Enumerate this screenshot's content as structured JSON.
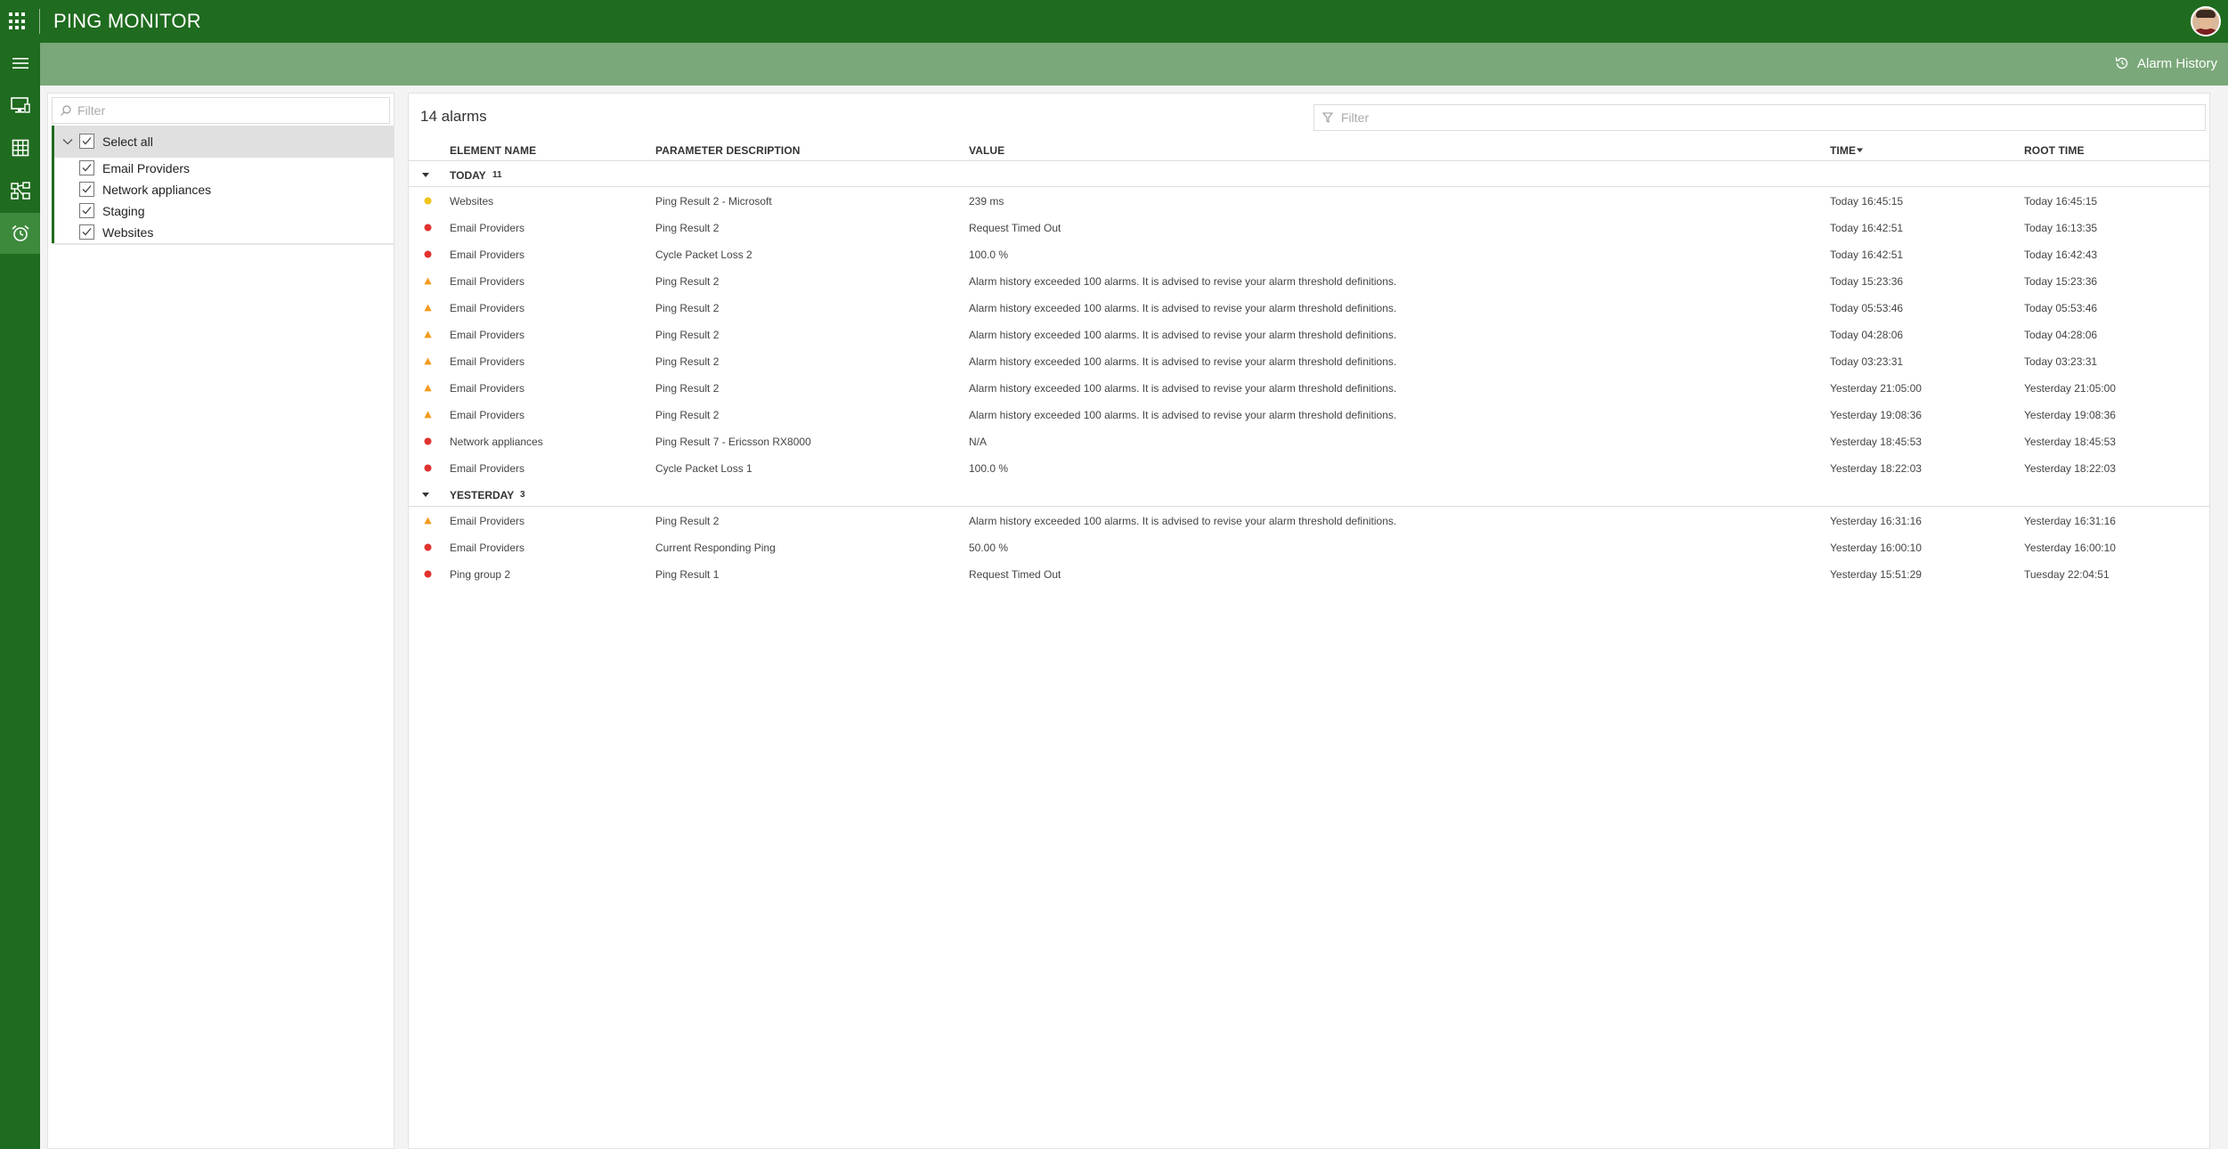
{
  "header": {
    "app_title": "PING MONITOR",
    "alarm_history_label": "Alarm History"
  },
  "rail": {
    "items": [
      {
        "name": "hamburger-menu-icon"
      },
      {
        "name": "monitor-icon"
      },
      {
        "name": "grid-icon"
      },
      {
        "name": "topology-icon"
      },
      {
        "name": "alarm-clock-icon",
        "active": true
      }
    ]
  },
  "left_panel": {
    "filter_placeholder": "Filter",
    "select_all_label": "Select all",
    "items": [
      {
        "label": "Email Providers",
        "checked": true
      },
      {
        "label": "Network appliances",
        "checked": true
      },
      {
        "label": "Staging",
        "checked": true
      },
      {
        "label": "Websites",
        "checked": true
      }
    ]
  },
  "main": {
    "alarm_count": "14 alarms",
    "filter_placeholder": "Filter",
    "columns": {
      "element": "ELEMENT NAME",
      "parameter": "PARAMETER DESCRIPTION",
      "value": "VALUE",
      "time": "TIME",
      "root_time": "ROOT TIME"
    },
    "groups": [
      {
        "name": "TODAY",
        "count": "11",
        "rows": [
          {
            "severity": "minor",
            "element": "Websites",
            "parameter": "Ping Result 2 - Microsoft",
            "value": "239 ms",
            "time": "Today 16:45:15",
            "root_time": "Today 16:45:15"
          },
          {
            "severity": "critical",
            "element": "Email Providers",
            "parameter": "Ping Result 2",
            "value": "Request Timed Out",
            "time": "Today 16:42:51",
            "root_time": "Today 16:13:35"
          },
          {
            "severity": "critical",
            "element": "Email Providers",
            "parameter": "Cycle Packet Loss 2",
            "value": "100.0 %",
            "time": "Today 16:42:51",
            "root_time": "Today 16:42:43"
          },
          {
            "severity": "warning",
            "element": "Email Providers",
            "parameter": "Ping Result 2",
            "value": "Alarm history exceeded 100 alarms. It is advised to revise your alarm threshold definitions.",
            "time": "Today 15:23:36",
            "root_time": "Today 15:23:36"
          },
          {
            "severity": "warning",
            "element": "Email Providers",
            "parameter": "Ping Result 2",
            "value": "Alarm history exceeded 100 alarms. It is advised to revise your alarm threshold definitions.",
            "time": "Today 05:53:46",
            "root_time": "Today 05:53:46"
          },
          {
            "severity": "warning",
            "element": "Email Providers",
            "parameter": "Ping Result 2",
            "value": "Alarm history exceeded 100 alarms. It is advised to revise your alarm threshold definitions.",
            "time": "Today 04:28:06",
            "root_time": "Today 04:28:06"
          },
          {
            "severity": "warning",
            "element": "Email Providers",
            "parameter": "Ping Result 2",
            "value": "Alarm history exceeded 100 alarms. It is advised to revise your alarm threshold definitions.",
            "time": "Today 03:23:31",
            "root_time": "Today 03:23:31"
          },
          {
            "severity": "warning",
            "element": "Email Providers",
            "parameter": "Ping Result 2",
            "value": "Alarm history exceeded 100 alarms. It is advised to revise your alarm threshold definitions.",
            "time": "Yesterday 21:05:00",
            "root_time": "Yesterday 21:05:00"
          },
          {
            "severity": "warning",
            "element": "Email Providers",
            "parameter": "Ping Result 2",
            "value": "Alarm history exceeded 100 alarms. It is advised to revise your alarm threshold definitions.",
            "time": "Yesterday 19:08:36",
            "root_time": "Yesterday 19:08:36"
          },
          {
            "severity": "critical",
            "element": "Network appliances",
            "parameter": "Ping Result 7 - Ericsson RX8000",
            "value": "N/A",
            "time": "Yesterday 18:45:53",
            "root_time": "Yesterday 18:45:53"
          },
          {
            "severity": "critical",
            "element": "Email Providers",
            "parameter": "Cycle Packet Loss 1",
            "value": "100.0 %",
            "time": "Yesterday 18:22:03",
            "root_time": "Yesterday 18:22:03"
          }
        ]
      },
      {
        "name": "YESTERDAY",
        "count": "3",
        "rows": [
          {
            "severity": "warning",
            "element": "Email Providers",
            "parameter": "Ping Result 2",
            "value": "Alarm history exceeded 100 alarms. It is advised to revise your alarm threshold definitions.",
            "time": "Yesterday 16:31:16",
            "root_time": "Yesterday 16:31:16"
          },
          {
            "severity": "critical",
            "element": "Email Providers",
            "parameter": "Current Responding Ping",
            "value": "50.00 %",
            "time": "Yesterday 16:00:10",
            "root_time": "Yesterday 16:00:10"
          },
          {
            "severity": "critical",
            "element": "Ping group 2",
            "parameter": "Ping Result 1",
            "value": "Request Timed Out",
            "time": "Yesterday 15:51:29",
            "root_time": "Tuesday 22:04:51"
          }
        ]
      }
    ]
  },
  "colors": {
    "brand_dark": "#1f6b1f",
    "brand_light": "#7aa87a",
    "critical": "#e0322f",
    "minor": "#f0c419",
    "warning": "#f29b1d"
  }
}
